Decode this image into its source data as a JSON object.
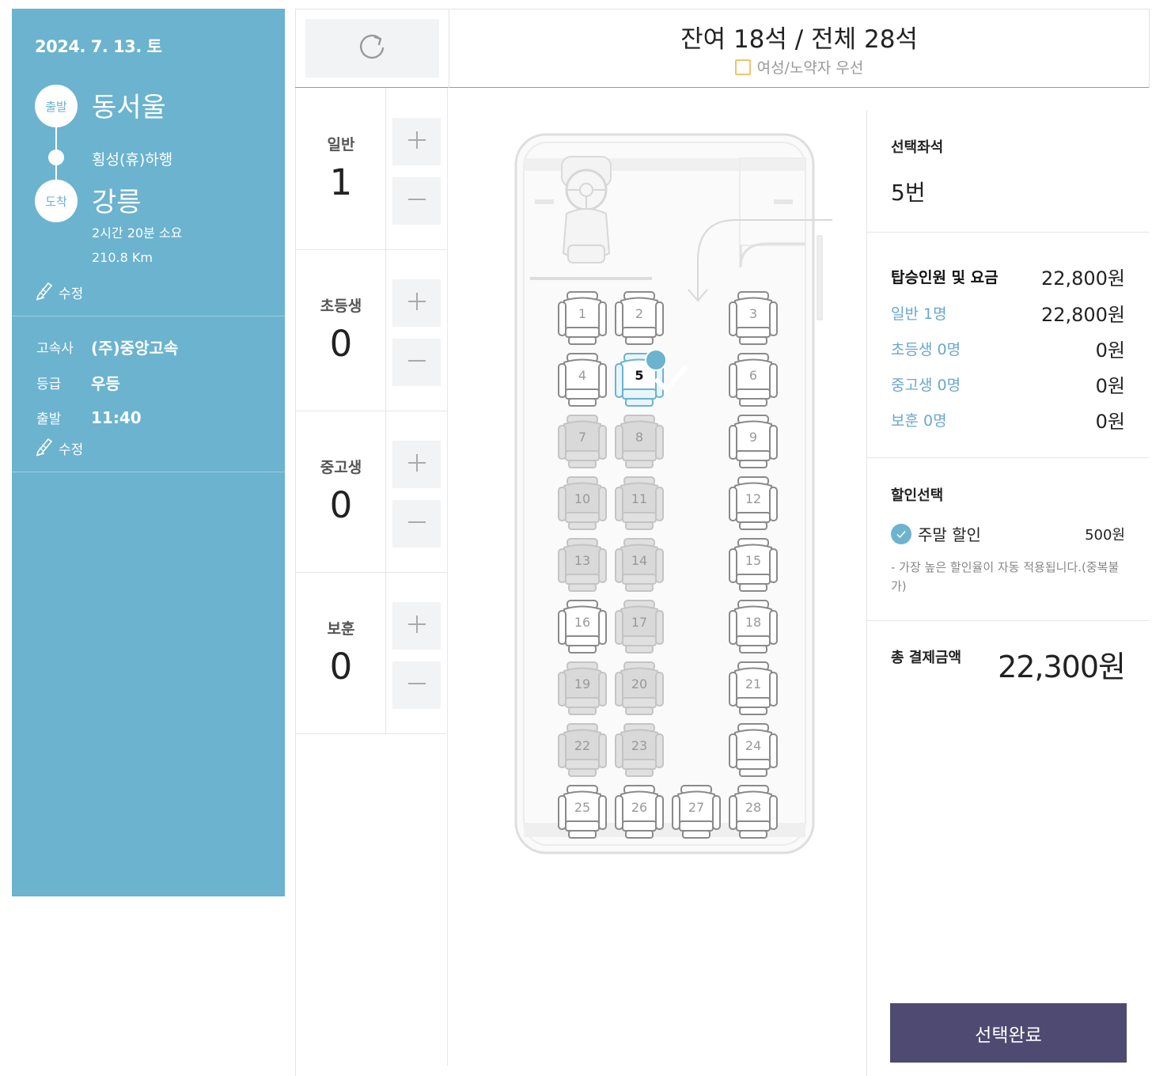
{
  "sidebar": {
    "date": "2024. 7. 13. 토",
    "departure_badge": "출발",
    "departure": "동서울",
    "via": "횡성(휴)하행",
    "arrival_badge": "도착",
    "arrival": "강릉",
    "duration": "2시간 20분 소요",
    "distance": "210.8 Km",
    "edit_label": "수정",
    "company_label": "고속사",
    "company": "(주)중앙고속",
    "grade_label": "등급",
    "grade": "우등",
    "depart_label": "출발",
    "depart_time": "11:40",
    "accent": "#6bb3cf"
  },
  "header": {
    "seat_count": "잔여 18석 / 전체 28석",
    "priority_label": "여성/노약자 우선"
  },
  "passengers": [
    {
      "name": "일반",
      "count": "1"
    },
    {
      "name": "초등생",
      "count": "0"
    },
    {
      "name": "중고생",
      "count": "0"
    },
    {
      "name": "보훈",
      "count": "0"
    }
  ],
  "seats": [
    {
      "num": "1",
      "status": "available"
    },
    {
      "num": "2",
      "status": "available"
    },
    {
      "num": "3",
      "status": "available"
    },
    {
      "num": "4",
      "status": "available"
    },
    {
      "num": "5",
      "status": "selected"
    },
    {
      "num": "6",
      "status": "available"
    },
    {
      "num": "7",
      "status": "taken"
    },
    {
      "num": "8",
      "status": "taken"
    },
    {
      "num": "9",
      "status": "available"
    },
    {
      "num": "10",
      "status": "taken"
    },
    {
      "num": "11",
      "status": "taken"
    },
    {
      "num": "12",
      "status": "available"
    },
    {
      "num": "13",
      "status": "taken"
    },
    {
      "num": "14",
      "status": "taken"
    },
    {
      "num": "15",
      "status": "available"
    },
    {
      "num": "16",
      "status": "available"
    },
    {
      "num": "17",
      "status": "taken"
    },
    {
      "num": "18",
      "status": "available"
    },
    {
      "num": "19",
      "status": "taken"
    },
    {
      "num": "20",
      "status": "taken"
    },
    {
      "num": "21",
      "status": "available"
    },
    {
      "num": "22",
      "status": "taken"
    },
    {
      "num": "23",
      "status": "taken"
    },
    {
      "num": "24",
      "status": "available"
    },
    {
      "num": "25",
      "status": "available"
    },
    {
      "num": "26",
      "status": "available"
    },
    {
      "num": "27",
      "status": "available"
    },
    {
      "num": "28",
      "status": "available"
    }
  ],
  "summary": {
    "selected_title": "선택좌석",
    "selected_value": "5번",
    "fare_title": "탑승인원 및 요금",
    "fare_total": "22,800원",
    "general_label": "일반 1명",
    "general_amount": "22,800원",
    "elementary_label": "초등생 0명",
    "elementary_amount": "0원",
    "middle_label": "중고생 0명",
    "middle_amount": "0원",
    "veteran_label": "보훈 0명",
    "veteran_amount": "0원",
    "discount_title": "할인선택",
    "discount_name": "주말 할인",
    "discount_amount": "500원",
    "discount_note": "- 가장 높은 할인율이 자동 적용됩니다.(중복불가)",
    "total_label": "총 결제금액",
    "total_value": "22,300원",
    "submit_label": "선택완료"
  },
  "colors": {
    "submit": "#4e4a71",
    "accent": "#6bb3cf",
    "priority_border": "#f2c46b",
    "taken_seat": "#d9d9d9"
  }
}
